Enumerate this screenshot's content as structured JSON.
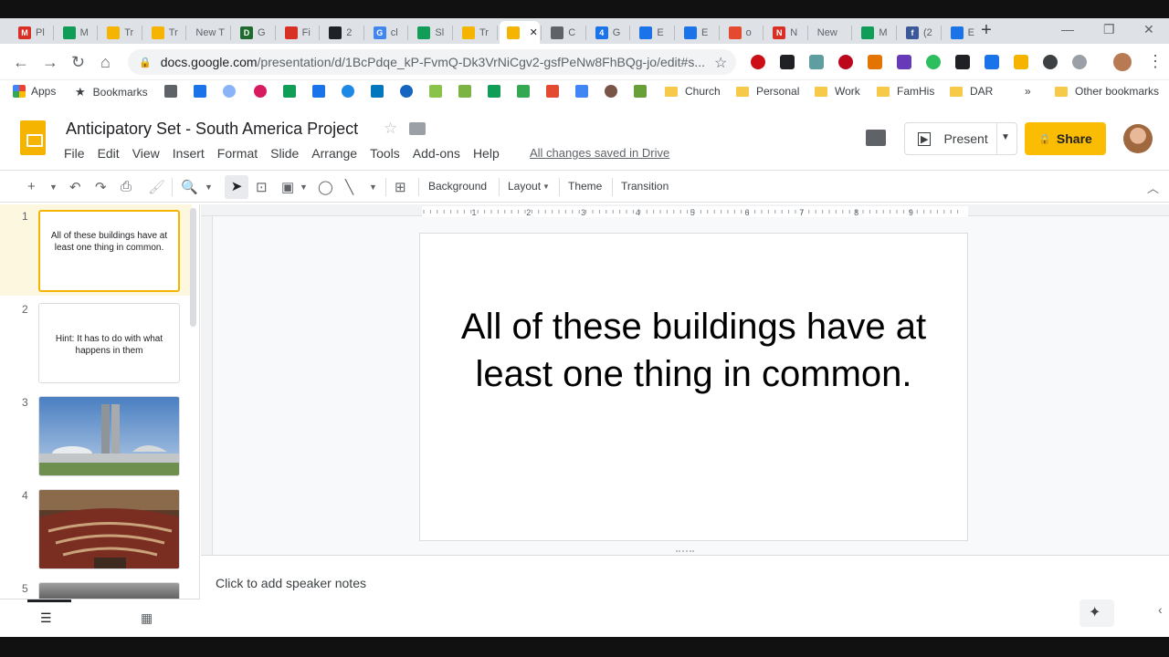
{
  "browser": {
    "tabs": [
      {
        "label": "Pl",
        "color": "#d93025",
        "glyph": "M"
      },
      {
        "label": "M",
        "color": "#0f9d58",
        "glyph": ""
      },
      {
        "label": "Tr",
        "color": "#f4b400",
        "glyph": ""
      },
      {
        "label": "Tr",
        "color": "#f4b400",
        "glyph": ""
      },
      {
        "label": "New T",
        "color": "",
        "glyph": ""
      },
      {
        "label": "G",
        "color": "#1e6b2e",
        "glyph": "D"
      },
      {
        "label": "Fi",
        "color": "#d93025",
        "glyph": ""
      },
      {
        "label": "2",
        "color": "#202124",
        "glyph": ""
      },
      {
        "label": "cl",
        "color": "#4285f4",
        "glyph": "G"
      },
      {
        "label": "Sl",
        "color": "#0f9d58",
        "glyph": ""
      },
      {
        "label": "Tr",
        "color": "#f4b400",
        "glyph": ""
      },
      {
        "label": "",
        "color": "#f4b400",
        "glyph": ""
      },
      {
        "label": "C",
        "color": "#5f6368",
        "glyph": ""
      },
      {
        "label": "G",
        "color": "#1a73e8",
        "glyph": "4"
      },
      {
        "label": "E",
        "color": "#1a73e8",
        "glyph": ""
      },
      {
        "label": "E",
        "color": "#1a73e8",
        "glyph": ""
      },
      {
        "label": "o",
        "color": "#e34a30",
        "glyph": ""
      },
      {
        "label": "N",
        "color": "#d93025",
        "glyph": "N"
      },
      {
        "label": "New",
        "color": "",
        "glyph": ""
      },
      {
        "label": "M",
        "color": "#0f9d58",
        "glyph": ""
      },
      {
        "label": "(2",
        "color": "#3b5998",
        "glyph": "f"
      },
      {
        "label": "E",
        "color": "#1a73e8",
        "glyph": ""
      }
    ],
    "url_host": "docs.google.com",
    "url_path": "/presentation/d/1BcPdqe_kP-FvmQ-Dk3VrNiCgv2-gsfPeNw8FhBQg-jo/edit#s...",
    "bookmarks": {
      "apps": "Apps",
      "bookmarks": "Bookmarks",
      "folders": [
        "Church",
        "Personal",
        "Work",
        "FamHis",
        "DAR"
      ],
      "more": "»",
      "other": "Other bookmarks"
    }
  },
  "app": {
    "title": "Anticipatory Set - South America Project",
    "menu": [
      "File",
      "Edit",
      "View",
      "Insert",
      "Format",
      "Slide",
      "Arrange",
      "Tools",
      "Add-ons",
      "Help"
    ],
    "saved_status": "All changes saved in Drive",
    "present_label": "Present",
    "share_label": "Share",
    "toolbar": {
      "background": "Background",
      "layout": "Layout",
      "theme": "Theme",
      "transition": "Transition"
    },
    "ruler_numbers": [
      "1",
      "2",
      "3",
      "4",
      "5",
      "6",
      "7",
      "8",
      "9"
    ],
    "slides": [
      {
        "number": "1",
        "text": "All of these buildings have at least one thing in common."
      },
      {
        "number": "2",
        "text": "Hint: It has to do with what happens in them"
      },
      {
        "number": "3",
        "text": ""
      },
      {
        "number": "4",
        "text": ""
      },
      {
        "number": "5",
        "text": ""
      }
    ],
    "current_slide_text": "All of these buildings have at least one thing in common.",
    "speaker_notes_placeholder": "Click to add speaker notes"
  }
}
